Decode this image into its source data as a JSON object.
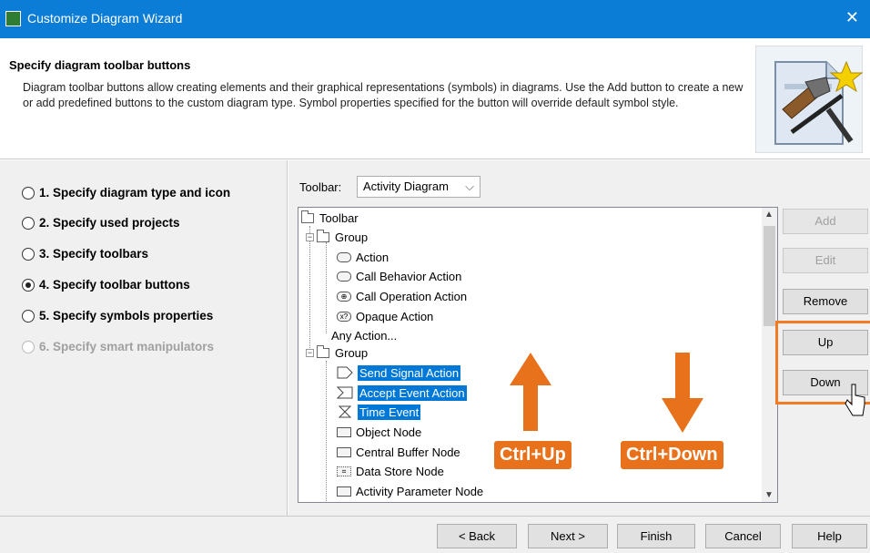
{
  "window": {
    "title": "Customize Diagram Wizard",
    "close": "✕"
  },
  "header": {
    "heading": "Specify diagram toolbar buttons",
    "description": "Diagram toolbar buttons allow creating elements and their graphical representations (symbols) in diagrams. Use the Add button to create a new or add predefined buttons to the custom diagram type. Symbol properties specified for the button will override default symbol style."
  },
  "steps": [
    {
      "label": "1. Specify diagram type and icon",
      "selected": false,
      "enabled": true
    },
    {
      "label": "2. Specify used projects",
      "selected": false,
      "enabled": true
    },
    {
      "label": "3. Specify toolbars",
      "selected": false,
      "enabled": true
    },
    {
      "label": "4. Specify toolbar buttons",
      "selected": true,
      "enabled": true
    },
    {
      "label": "5. Specify symbols properties",
      "selected": false,
      "enabled": true
    },
    {
      "label": "6. Specify smart manipulators",
      "selected": false,
      "enabled": false
    }
  ],
  "toolbar": {
    "label": "Toolbar:",
    "value": "Activity Diagram"
  },
  "tree": {
    "root": "Toolbar",
    "group1": "Group",
    "group1_items": [
      "Action",
      "Call Behavior Action",
      "Call Operation Action",
      "Opaque Action",
      "Any Action..."
    ],
    "group2": "Group",
    "group2_items": [
      "Send Signal Action",
      "Accept Event Action",
      "Time Event",
      "Object Node",
      "Central Buffer Node",
      "Data Store Node",
      "Activity Parameter Node"
    ],
    "selected": [
      "Send Signal Action",
      "Accept Event Action",
      "Time Event"
    ]
  },
  "side_buttons": {
    "add": "Add",
    "edit": "Edit",
    "remove": "Remove",
    "up": "Up",
    "down": "Down"
  },
  "annotations": {
    "up": "Ctrl+Up",
    "down": "Ctrl+Down",
    "accent": "#e8721c"
  },
  "footer": {
    "back": "< Back",
    "next": "Next >",
    "finish": "Finish",
    "cancel": "Cancel",
    "help": "Help"
  },
  "colors": {
    "titlebar": "#0b7dd6",
    "selection": "#0078d7"
  }
}
